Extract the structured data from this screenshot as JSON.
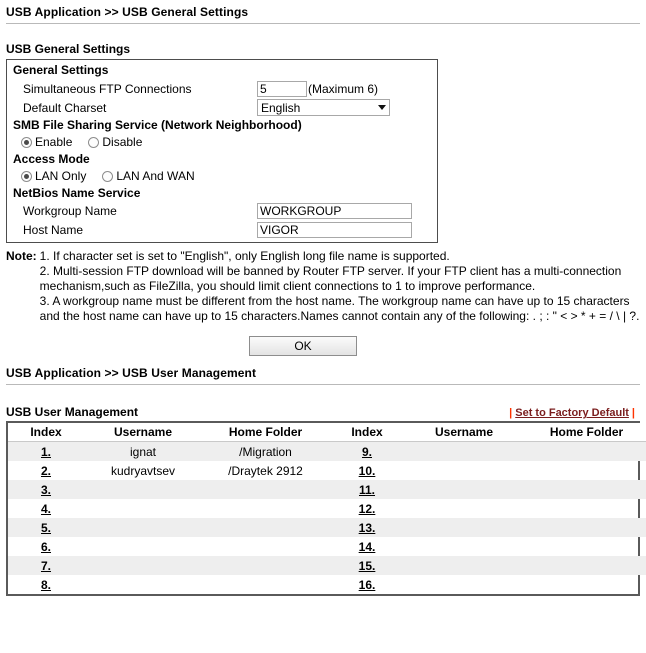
{
  "page1": {
    "breadcrumb": "USB Application >> USB General Settings",
    "section_title": "USB General Settings",
    "box": {
      "head": "General Settings",
      "ftp_label": "Simultaneous FTP Connections",
      "ftp_value": "5",
      "ftp_max_note": "(Maximum 6)",
      "charset_label": "Default Charset",
      "charset_value": "English",
      "smb_head": "SMB File Sharing Service (Network Neighborhood)",
      "smb_enable": "Enable",
      "smb_disable": "Disable",
      "smb_selected": "Enable",
      "access_head": "Access Mode",
      "access_lan_only": "LAN Only",
      "access_lan_wan": "LAN And WAN",
      "access_selected": "LAN Only",
      "netbios_head": "NetBios Name Service",
      "workgroup_label": "Workgroup Name",
      "workgroup_value": "WORKGROUP",
      "host_label": "Host Name",
      "host_value": "VIGOR"
    },
    "note_label": "Note:",
    "notes": [
      "1. If character set is set to \"English\", only English long file name is supported.",
      "2. Multi-session FTP download will be banned by Router FTP server. If your FTP client has a multi-connection mechanism,such as FileZilla, you should limit client connections to 1 to improve performance.",
      "3. A workgroup name must be different from the host name. The workgroup name can have up to 15 characters and the host name can have up to 15 characters.Names cannot contain any of the following: . ; : \" < > * + = / \\ | ?."
    ],
    "ok_button": "OK"
  },
  "page2": {
    "breadcrumb": "USB Application >> USB User Management",
    "section_title": "USB User Management",
    "factory_default_link": "Set to Factory Default",
    "pipe": "|",
    "headers": [
      "Index",
      "Username",
      "Home Folder",
      "Index",
      "Username",
      "Home Folder"
    ],
    "rows": [
      {
        "left_index": "1.",
        "left_user": "ignat",
        "left_home": "/Migration",
        "right_index": "9.",
        "right_user": "",
        "right_home": ""
      },
      {
        "left_index": "2.",
        "left_user": "kudryavtsev",
        "left_home": "/Draytek 2912",
        "right_index": "10.",
        "right_user": "",
        "right_home": ""
      },
      {
        "left_index": "3.",
        "left_user": "",
        "left_home": "",
        "right_index": "11.",
        "right_user": "",
        "right_home": ""
      },
      {
        "left_index": "4.",
        "left_user": "",
        "left_home": "",
        "right_index": "12.",
        "right_user": "",
        "right_home": ""
      },
      {
        "left_index": "5.",
        "left_user": "",
        "left_home": "",
        "right_index": "13.",
        "right_user": "",
        "right_home": ""
      },
      {
        "left_index": "6.",
        "left_user": "",
        "left_home": "",
        "right_index": "14.",
        "right_user": "",
        "right_home": ""
      },
      {
        "left_index": "7.",
        "left_user": "",
        "left_home": "",
        "right_index": "15.",
        "right_user": "",
        "right_home": ""
      },
      {
        "left_index": "8.",
        "left_user": "",
        "left_home": "",
        "right_index": "16.",
        "right_user": "",
        "right_home": ""
      }
    ]
  },
  "colors": {
    "link_red": "#7a1d1d",
    "pipe_red": "#ff3300",
    "row_alt": "#eeeeee",
    "border": "#5a5a5a"
  }
}
